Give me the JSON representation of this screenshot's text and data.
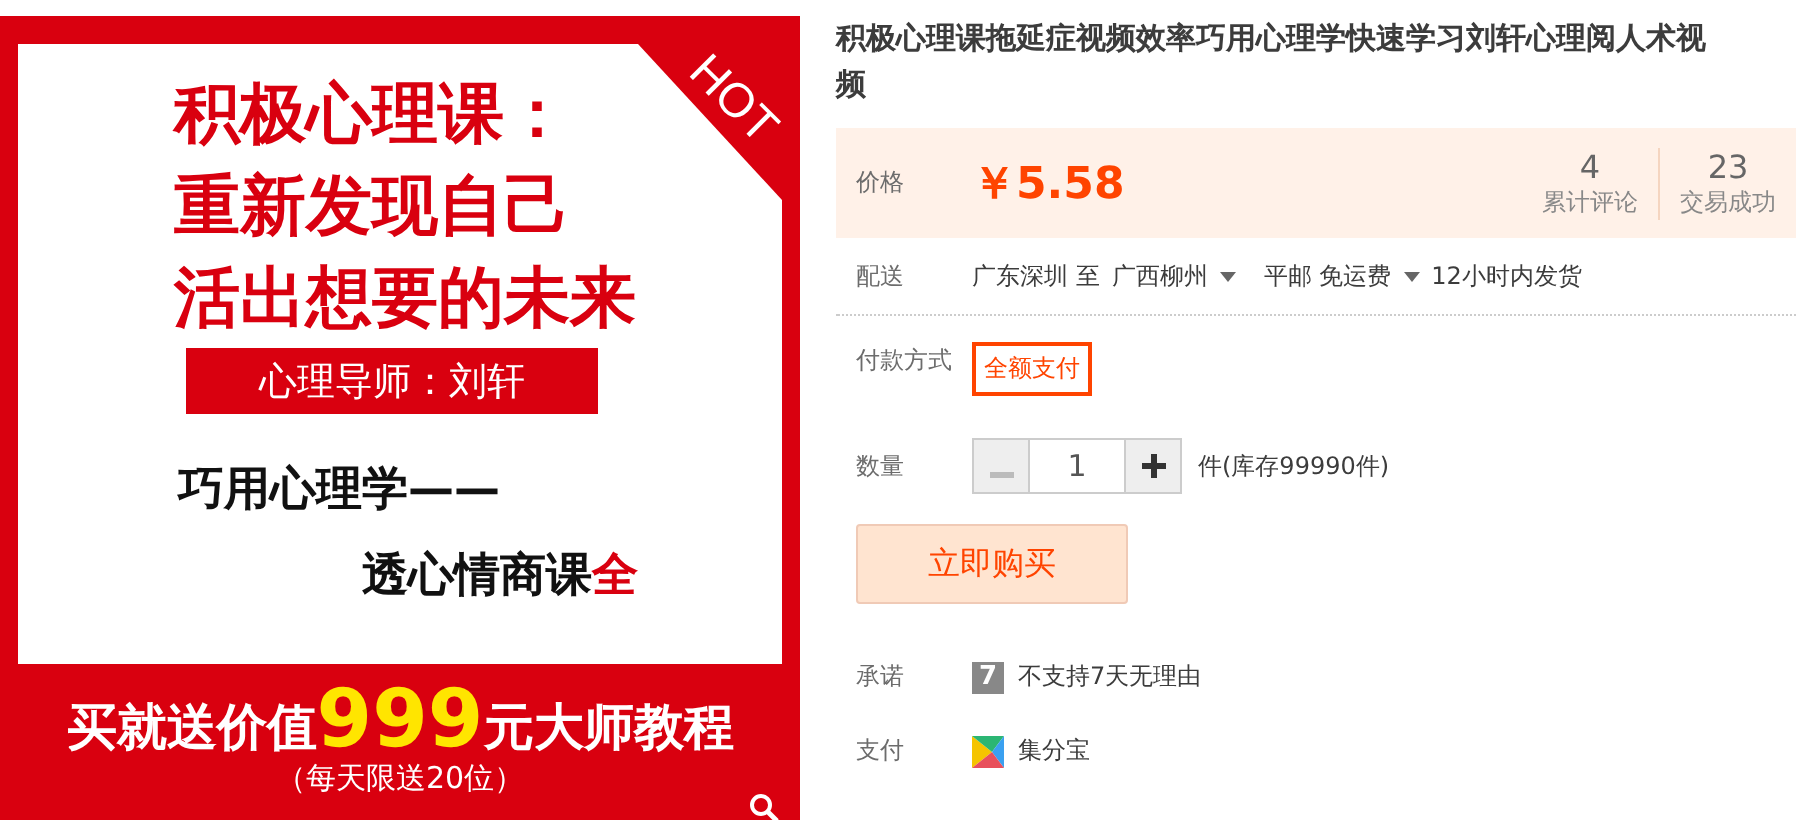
{
  "product_image": {
    "hot_tag": "HOT",
    "headline": [
      "积极心理课：",
      "重新发现自己",
      "活出想要的未来"
    ],
    "teacher": "心理导师：刘轩",
    "subline": "巧用心理学——",
    "subline2": "透心情商课",
    "subline2_highlight": "全",
    "promo_before": "买就送价值",
    "promo_number": "999",
    "promo_after": "元大师教程",
    "promo_note": "（每天限送20位）"
  },
  "title": "积极心理课拖延症视频效率巧用心理学快速学习刘轩心理阅人术视频",
  "price": {
    "label": "价格",
    "currency": "￥",
    "amount": "5.58"
  },
  "stats": [
    {
      "value": "4",
      "label": "累计评论"
    },
    {
      "value": "23",
      "label": "交易成功"
    }
  ],
  "shipping": {
    "label": "配送",
    "from": "广东深圳 至",
    "to": "广西柳州",
    "method": "平邮 免运费",
    "dispatch": "12小时内发货"
  },
  "payment_mode": {
    "label": "付款方式",
    "options": [
      {
        "label": "全额支付",
        "selected": true
      }
    ]
  },
  "quantity": {
    "label": "数量",
    "minus_disabled": true,
    "value": "1",
    "stock": "件(库存99990件)"
  },
  "buy_button": "立即购买",
  "promise": {
    "label": "承诺",
    "icon_text": "7",
    "text": "不支持7天无理由"
  },
  "pay": {
    "label": "支付",
    "text": "集分宝"
  }
}
